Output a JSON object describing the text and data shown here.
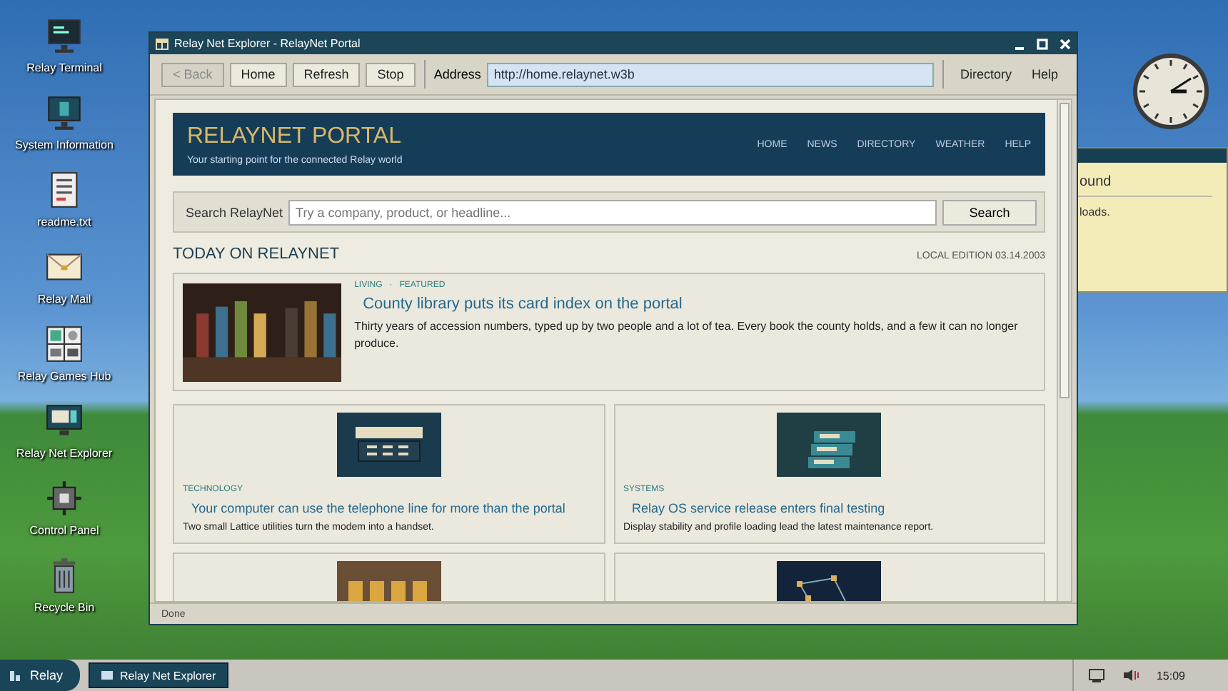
{
  "desktop_icons": [
    {
      "label": "Relay Terminal"
    },
    {
      "label": "System Information"
    },
    {
      "label": "readme.txt"
    },
    {
      "label": "Relay Mail"
    },
    {
      "label": "Relay Games Hub"
    },
    {
      "label": "Relay Net Explorer"
    },
    {
      "label": "Control Panel"
    },
    {
      "label": "Recycle Bin"
    }
  ],
  "note": {
    "title": "ound",
    "body": "loads."
  },
  "window": {
    "title": "Relay Net Explorer - RelayNet Portal",
    "toolbar": {
      "buttons": [
        {
          "label": "< Back",
          "disabled": true
        },
        {
          "label": "Home",
          "disabled": false
        },
        {
          "label": "Refresh",
          "disabled": false
        },
        {
          "label": "Stop",
          "disabled": false
        }
      ],
      "address_label": "Address",
      "address": "http://home.relaynet.w3b",
      "menu": [
        "Directory",
        "Help"
      ]
    },
    "page": {
      "banner": {
        "title": "RELAYNET PORTAL",
        "tagline": "Your starting point for the connected Relay world",
        "nav": [
          "HOME",
          "NEWS",
          "DIRECTORY",
          "WEATHER",
          "HELP"
        ]
      },
      "search": {
        "label": "Search RelayNet",
        "placeholder": "Try a company, product, or headline...",
        "button": "Search"
      },
      "section_title": "TODAY ON RELAYNET",
      "edition": "LOCAL EDITION 03.14.2003",
      "featured": {
        "tags": [
          "LIVING",
          "FEATURED"
        ],
        "tag_separator": "·",
        "title": "County library puts its card index on the portal",
        "summary": "Thirty years of accession numbers, typed up by two people and a lot of tea. Every book the county holds, and a few it can no longer produce."
      },
      "stories": [
        {
          "kind": "article",
          "category": "TECHNOLOGY",
          "title": "Your computer can use the telephone line for more than the portal",
          "summary": "Two small Lattice utilities turn the modem into a handset."
        },
        {
          "kind": "article",
          "category": "SYSTEMS",
          "title": "Relay OS service release enters final testing",
          "summary": "Display stability and profile loading lead the latest maintenance report."
        },
        {
          "kind": "image_only"
        },
        {
          "kind": "image_only"
        }
      ]
    },
    "status": "Done"
  },
  "taskbar": {
    "start": "Relay",
    "tasks": [
      {
        "label": "Relay Net Explorer",
        "selected": true
      }
    ],
    "time": "15:09"
  }
}
